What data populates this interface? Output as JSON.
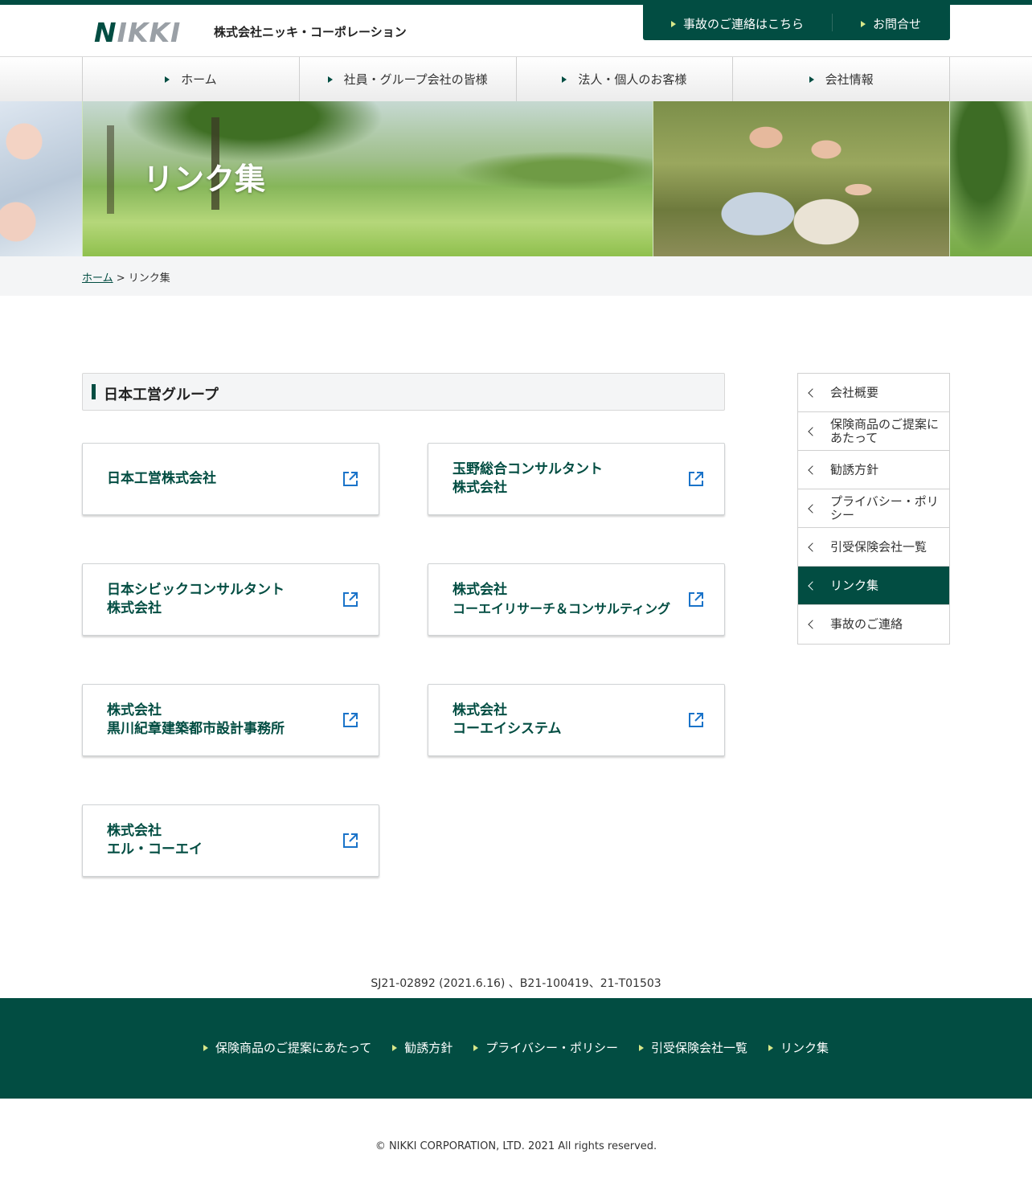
{
  "header": {
    "logo_n": "N",
    "logo_rest": "IKKI",
    "company_name": "株式会社ニッキ・コーポレーション",
    "accident_link": "事故のご連絡はこちら",
    "contact_link": "お問合せ"
  },
  "nav": {
    "items": [
      {
        "label": "ホーム"
      },
      {
        "label": "社員・グループ会社の皆様"
      },
      {
        "label": "法人・個人のお客様"
      },
      {
        "label": "会社情報"
      }
    ]
  },
  "hero": {
    "title": "リンク集"
  },
  "breadcrumb": {
    "home": "ホーム",
    "separator": " > ",
    "current": "リンク集"
  },
  "section": {
    "title": "日本工営グループ"
  },
  "links": [
    {
      "line1": "日本工営株式会社",
      "line2": ""
    },
    {
      "line1": "玉野総合コンサルタント",
      "line2": "株式会社"
    },
    {
      "line1": "日本シビックコンサルタント",
      "line2": "株式会社"
    },
    {
      "line1": "株式会社",
      "line2": "コーエイリサーチ＆コンサルティング"
    },
    {
      "line1": "株式会社",
      "line2": "黒川紀章建築都市設計事務所"
    },
    {
      "line1": "株式会社",
      "line2": "コーエイシステム"
    },
    {
      "line1": "株式会社",
      "line2": "エル・コーエイ"
    }
  ],
  "side_menu": {
    "items": [
      {
        "label": "会社概要",
        "active": false
      },
      {
        "label": "保険商品のご提案にあたって",
        "active": false
      },
      {
        "label": "勧誘方針",
        "active": false
      },
      {
        "label": "プライバシー・ポリシー",
        "active": false
      },
      {
        "label": "引受保険会社一覧",
        "active": false
      },
      {
        "label": "リンク集",
        "active": true
      },
      {
        "label": "事故のご連絡",
        "active": false
      }
    ]
  },
  "registration": "SJ21-02892 (2021.6.16) 、B21-100419、21-T01503",
  "footer": {
    "links": [
      {
        "label": "保険商品のご提案にあたって"
      },
      {
        "label": "勧誘方針"
      },
      {
        "label": "プライバシー・ポリシー"
      },
      {
        "label": "引受保険会社一覧"
      },
      {
        "label": "リンク集"
      }
    ],
    "copyright": "© NIKKI CORPORATION, LTD. 2021 All rights reserved."
  },
  "colors": {
    "brand_green": "#024d42",
    "accent_triangle": "#d8e88a",
    "external_icon": "#1a73c9"
  },
  "icons": {
    "external": "external-link-icon",
    "chevron": "chevron-left-icon",
    "triangle": "triangle-right-icon"
  }
}
